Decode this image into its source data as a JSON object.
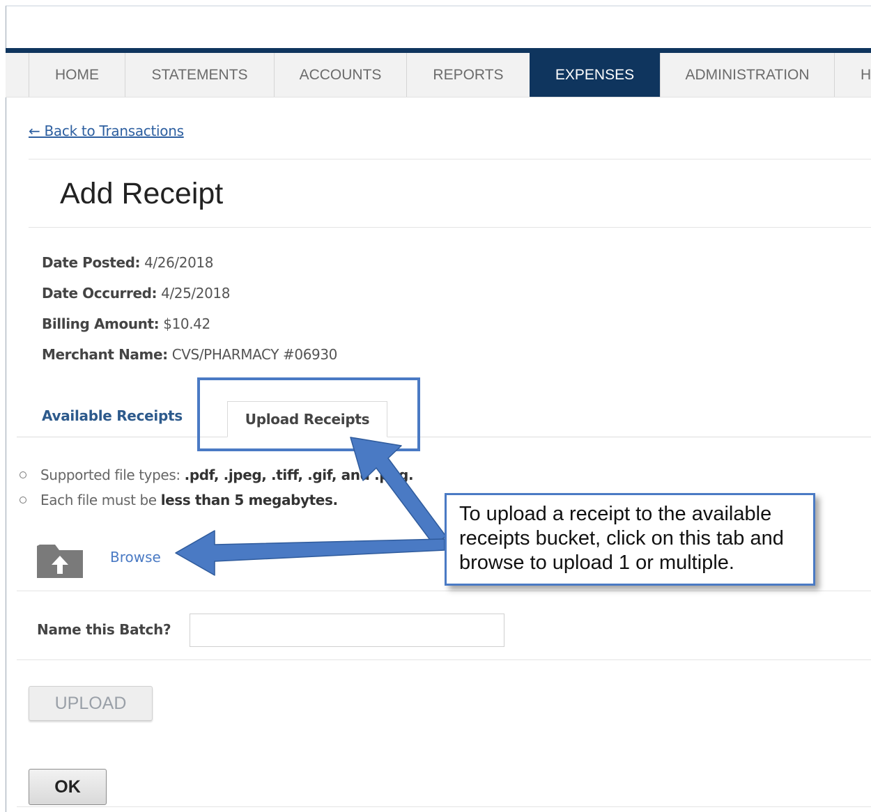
{
  "nav": {
    "tabs": [
      {
        "label": "HOME"
      },
      {
        "label": "STATEMENTS"
      },
      {
        "label": "ACCOUNTS"
      },
      {
        "label": "REPORTS"
      },
      {
        "label": "EXPENSES",
        "active": true
      },
      {
        "label": "ADMINISTRATION"
      },
      {
        "label": "H"
      }
    ]
  },
  "back_link": "← Back to Transactions",
  "page_title": "Add Receipt",
  "details": {
    "date_posted": {
      "label": "Date Posted:",
      "value": "4/26/2018"
    },
    "date_occurred": {
      "label": "Date Occurred:",
      "value": "4/25/2018"
    },
    "billing_amount": {
      "label": "Billing Amount:",
      "value": "$10.42"
    },
    "merchant_name": {
      "label": "Merchant Name:",
      "value": "CVS/PHARMACY #06930"
    }
  },
  "tabs": {
    "available": "Available Receipts",
    "upload": "Upload Receipts"
  },
  "requirements": {
    "file_types_prefix": "Supported file types: ",
    "file_types": ".pdf, .jpeg, .tiff, .gif, ",
    "file_types_suffix": "and .png.",
    "size_prefix": "Each file must be ",
    "size_limit": "less than 5 megabytes."
  },
  "browse_label": "Browse",
  "batch": {
    "label": "Name this Batch?",
    "value": ""
  },
  "buttons": {
    "upload": "UPLOAD",
    "ok": "OK"
  },
  "callout": "To upload a receipt to the available receipts bucket, click on this tab and browse to upload 1 or multiple.",
  "colors": {
    "nav_active": "#0f355e",
    "link": "#2d5fa0",
    "annotation": "#4a7ac4"
  },
  "icons": {
    "upload_folder": "folder-upload-icon"
  }
}
